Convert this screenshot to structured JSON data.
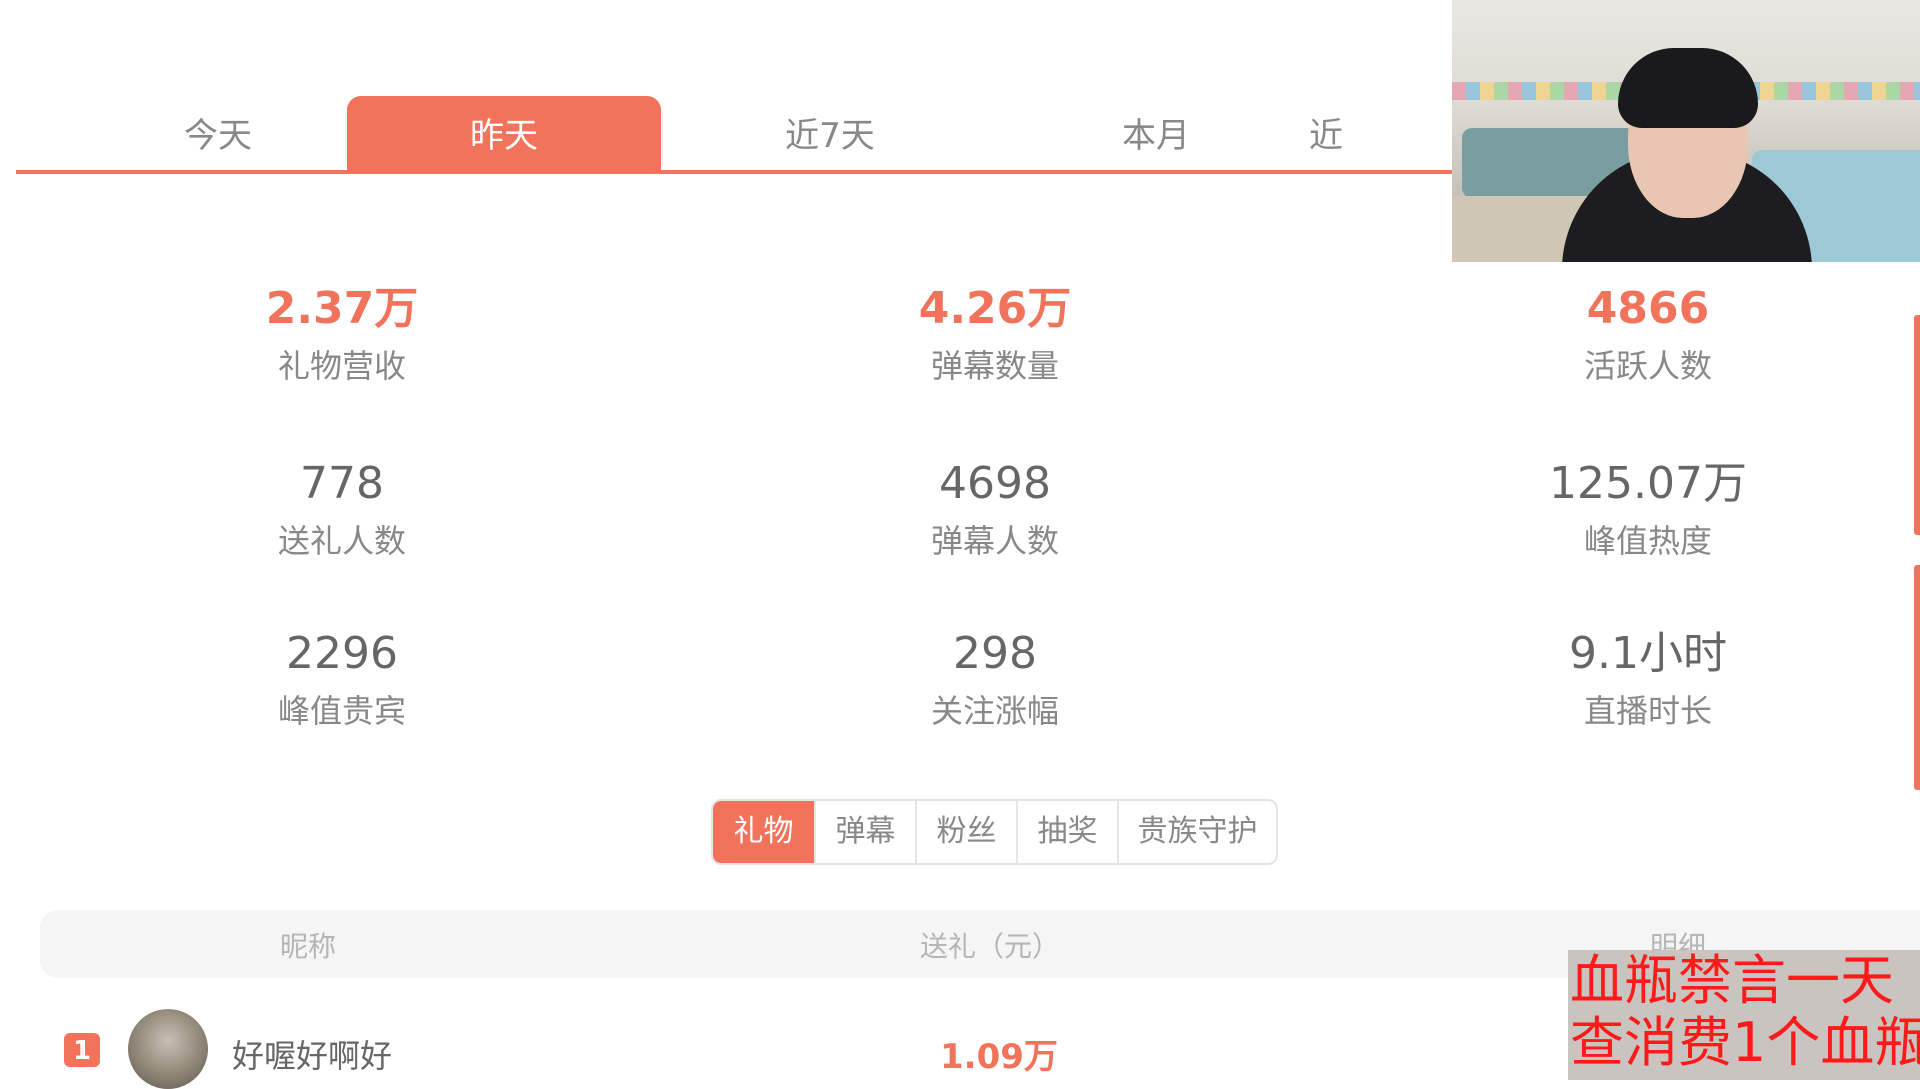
{
  "period_tabs": [
    {
      "label": "今天",
      "active": false
    },
    {
      "label": "昨天",
      "active": true
    },
    {
      "label": "近7天",
      "active": false
    },
    {
      "label": "本月",
      "active": false
    },
    {
      "label": "近",
      "active": false
    }
  ],
  "stats": [
    {
      "value": "2.37万",
      "label": "礼物营收",
      "highlight": true
    },
    {
      "value": "4.26万",
      "label": "弹幕数量",
      "highlight": true
    },
    {
      "value": "4866",
      "label": "活跃人数",
      "highlight": true
    },
    {
      "value": "778",
      "label": "送礼人数",
      "highlight": false
    },
    {
      "value": "4698",
      "label": "弹幕人数",
      "highlight": false
    },
    {
      "value": "125.07万",
      "label": "峰值热度",
      "highlight": false
    },
    {
      "value": "2296",
      "label": "峰值贵宾",
      "highlight": false
    },
    {
      "value": "298",
      "label": "关注涨幅",
      "highlight": false
    },
    {
      "value": "9.1小时",
      "label": "直播时长",
      "highlight": false
    }
  ],
  "sub_tabs": [
    {
      "label": "礼物",
      "active": true
    },
    {
      "label": "弹幕",
      "active": false
    },
    {
      "label": "粉丝",
      "active": false
    },
    {
      "label": "抽奖",
      "active": false
    },
    {
      "label": "贵族守护",
      "active": false
    }
  ],
  "table": {
    "headers": {
      "nickname": "昵称",
      "gift": "送礼（元）",
      "detail": "明细"
    },
    "rows": [
      {
        "rank": "1",
        "nickname": "好喔好啊好",
        "amount": "1.09万"
      }
    ]
  },
  "overlay": {
    "line1": "血瓶禁言一天",
    "line2": "查消费1个血瓶"
  },
  "colors": {
    "accent": "#f2735b",
    "overlay_text": "#ff1a1a"
  }
}
